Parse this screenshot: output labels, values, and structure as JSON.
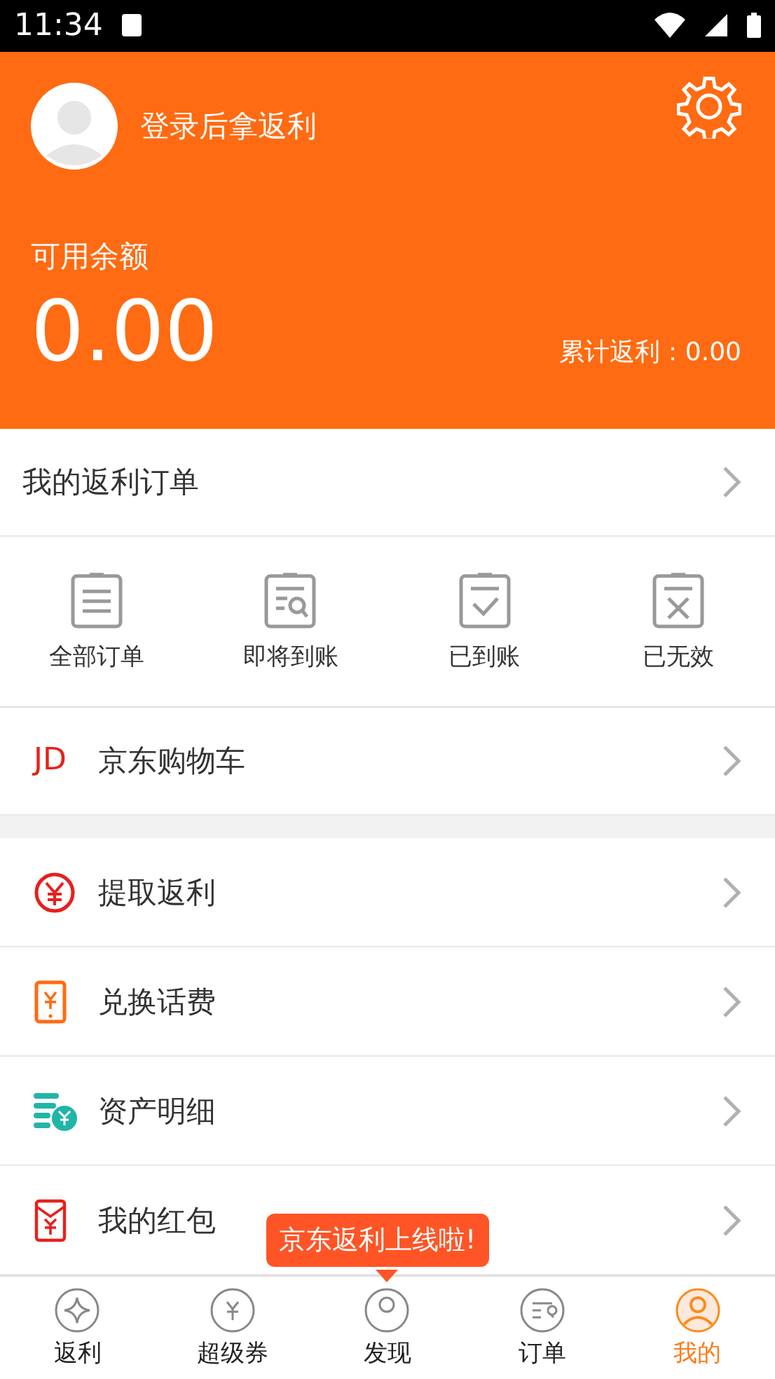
{
  "status_bar": {
    "time": "11:34"
  },
  "header": {
    "login_prompt": "登录后拿返利",
    "balance_label": "可用余额",
    "balance": "0.00",
    "total_rebate": "累计返利：0.00"
  },
  "orders": {
    "title": "我的返利订单",
    "items": [
      {
        "label": "全部订单",
        "kind": "all"
      },
      {
        "label": "即将到账",
        "kind": "pending"
      },
      {
        "label": "已到账",
        "kind": "done"
      },
      {
        "label": "已无效",
        "kind": "invalid"
      }
    ]
  },
  "cart": {
    "logo": "JD",
    "label": "京东购物车"
  },
  "menu": [
    {
      "label": "提取返利",
      "kind": "yuan"
    },
    {
      "label": "兑换话费",
      "kind": "phone"
    },
    {
      "label": "资产明细",
      "kind": "coins"
    },
    {
      "label": "我的红包",
      "kind": "envelope"
    }
  ],
  "tooltip": "京东返利上线啦!",
  "tabs": [
    {
      "label": "返利",
      "kind": "star",
      "selected": false
    },
    {
      "label": "超级券",
      "kind": "coupon",
      "selected": false
    },
    {
      "label": "发现",
      "kind": "discover",
      "selected": false
    },
    {
      "label": "订单",
      "kind": "order",
      "selected": false
    },
    {
      "label": "我的",
      "kind": "me",
      "selected": true
    }
  ]
}
